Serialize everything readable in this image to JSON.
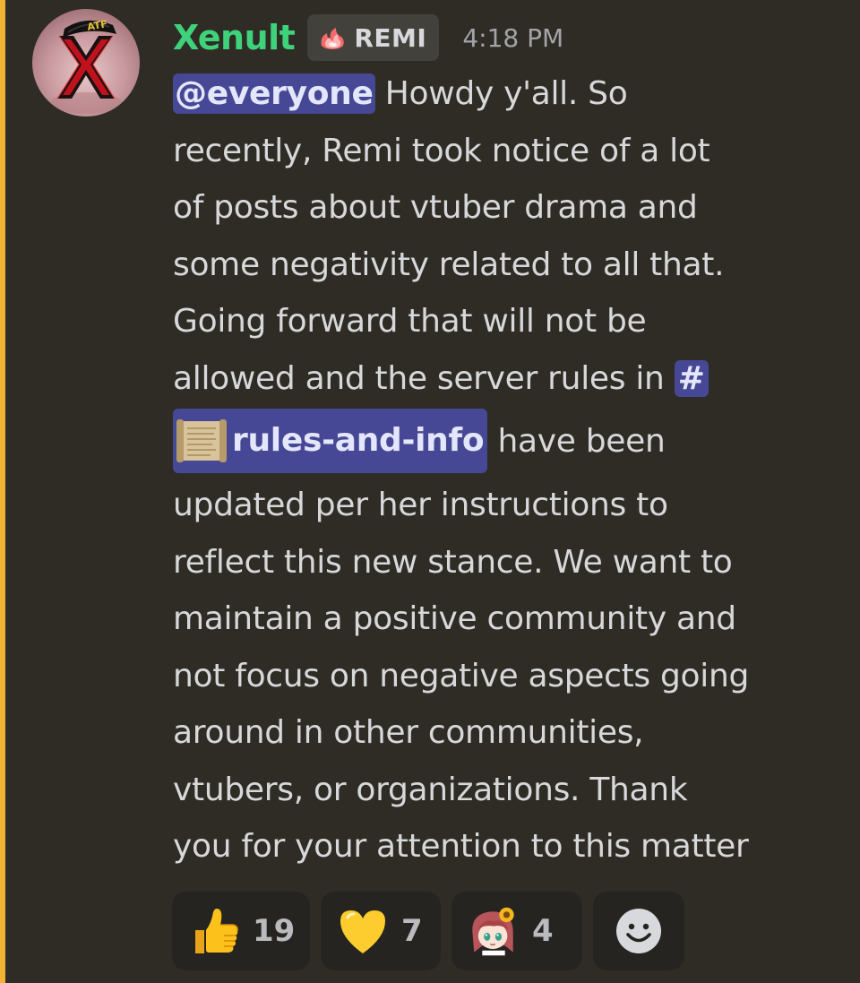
{
  "message": {
    "author": {
      "username": "Xenult",
      "avatar_icon": "x-logo-avatar",
      "username_color": "#3ed37a"
    },
    "tag": {
      "icon": "pink-flame-icon",
      "label": "REMI"
    },
    "timestamp": "4:18 PM",
    "mention_everyone": "@everyone",
    "content": {
      "l1_after_mention": " Howdy y'all. So",
      "l2": "recently, Remi took notice of a lot",
      "l3": "of posts about vtuber drama and",
      "l4": "some negativity related to all that.",
      "l5": "Going forward that will not be",
      "l6_before_channel": "allowed and the server rules in ",
      "channel_hash": "#",
      "channel_name": "rules-and-info",
      "l7_after_channel": " have been",
      "l8": "updated per her instructions to",
      "l9": "reflect this new stance. We want to",
      "l10": "maintain a positive community and",
      "l11": "not focus on negative aspects going",
      "l12": "around in other communities,",
      "l13": "vtubers, or organizations. Thank",
      "l14": "you for your attention to this matter"
    },
    "reactions": [
      {
        "emoji": "thumbs-up-emoji",
        "count": "19"
      },
      {
        "emoji": "yellow-heart-emoji",
        "count": "7"
      },
      {
        "emoji": "custom-anime-girl-sunflower-emoji",
        "count": "4"
      }
    ],
    "add_reaction_icon": "smiley-add-reaction-icon",
    "colors": {
      "mention_bar": "#f0b232",
      "mention_bg": "#464895",
      "background": "#2f2c25"
    }
  }
}
